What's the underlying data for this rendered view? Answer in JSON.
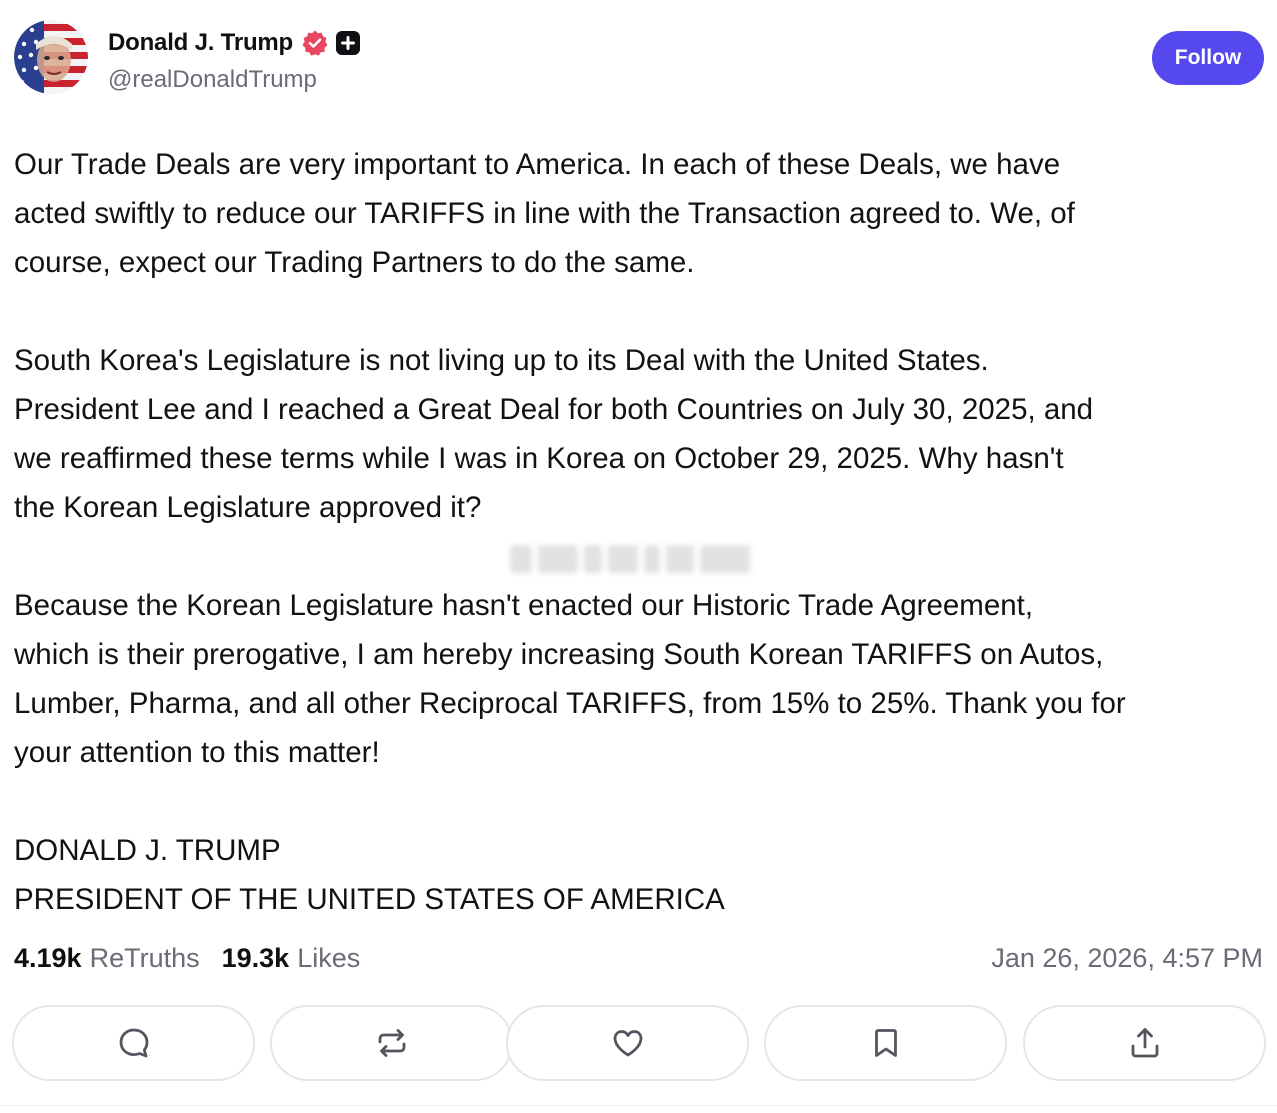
{
  "author": {
    "display_name": "Donald J. Trump",
    "handle": "@realDonaldTrump",
    "follow_label": "Follow",
    "avatar_icon": "flag-portrait-avatar",
    "verified_icon": "verified-check-icon",
    "badge_icon": "plus-badge-icon"
  },
  "post": {
    "paragraphs": [
      [
        "Our Trade Deals are very important to America. In each of these Deals, we have",
        "acted swiftly to reduce our TARIFFS in line with the Transaction agreed to. We, of",
        "course, expect our Trading Partners to do the same."
      ],
      [
        "South Korea's Legislature is not living up to its Deal with the United States.",
        "President Lee and I reached a Great Deal for both Countries on July 30, 2025, and",
        "we reaffirmed these terms while I was in Korea on October 29, 2025. Why hasn't",
        "the Korean Legislature approved it?"
      ],
      [
        "Because the Korean Legislature hasn't enacted our Historic Trade Agreement,",
        "which is their prerogative, I am hereby increasing South Korean TARIFFS on Autos,",
        "Lumber, Pharma, and all other Reciprocal TARIFFS, from 15% to 25%. Thank you for",
        "your attention to this matter!"
      ],
      [
        "DONALD J. TRUMP",
        "PRESIDENT OF THE UNITED STATES OF AMERICA"
      ]
    ]
  },
  "stats": {
    "retruths_count": "4.19k",
    "retruths_label": "ReTruths",
    "likes_count": "19.3k",
    "likes_label": "Likes",
    "timestamp": "Jan 26, 2026, 4:57 PM"
  },
  "actions": [
    {
      "name": "reply",
      "icon": "comment-icon"
    },
    {
      "name": "retruth",
      "icon": "repost-icon"
    },
    {
      "name": "like",
      "icon": "heart-icon"
    },
    {
      "name": "bookmark",
      "icon": "bookmark-icon"
    },
    {
      "name": "share",
      "icon": "share-icon"
    }
  ],
  "colors": {
    "accent": "#5448ee",
    "verified": "#e8475f",
    "muted_text": "#6b6b78",
    "border": "#e6e6ea"
  }
}
